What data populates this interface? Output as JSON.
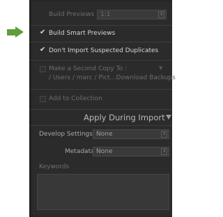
{
  "build_previews": {
    "label": "Build Previews",
    "value": "1:1"
  },
  "build_smart_previews": {
    "label": "Build Smart Previews",
    "checked": true
  },
  "dont_import_duplicates": {
    "label": "Don't Import Suspected Duplicates",
    "checked": true
  },
  "second_copy": {
    "label": "Make a Second Copy To :",
    "path": "/ Users / marc / Pict…Download Backups",
    "checked": false
  },
  "add_to_collection": {
    "label": "Add to Collection",
    "checked": false
  },
  "apply_section": {
    "title": "Apply During Import"
  },
  "develop_settings": {
    "label": "Develop Settings",
    "value": "None"
  },
  "metadata": {
    "label": "Metadata",
    "value": "None"
  },
  "keywords": {
    "label": "Keywords"
  },
  "colors": {
    "panel": "#2b2b2b",
    "arrow": "#5e9e3c"
  }
}
